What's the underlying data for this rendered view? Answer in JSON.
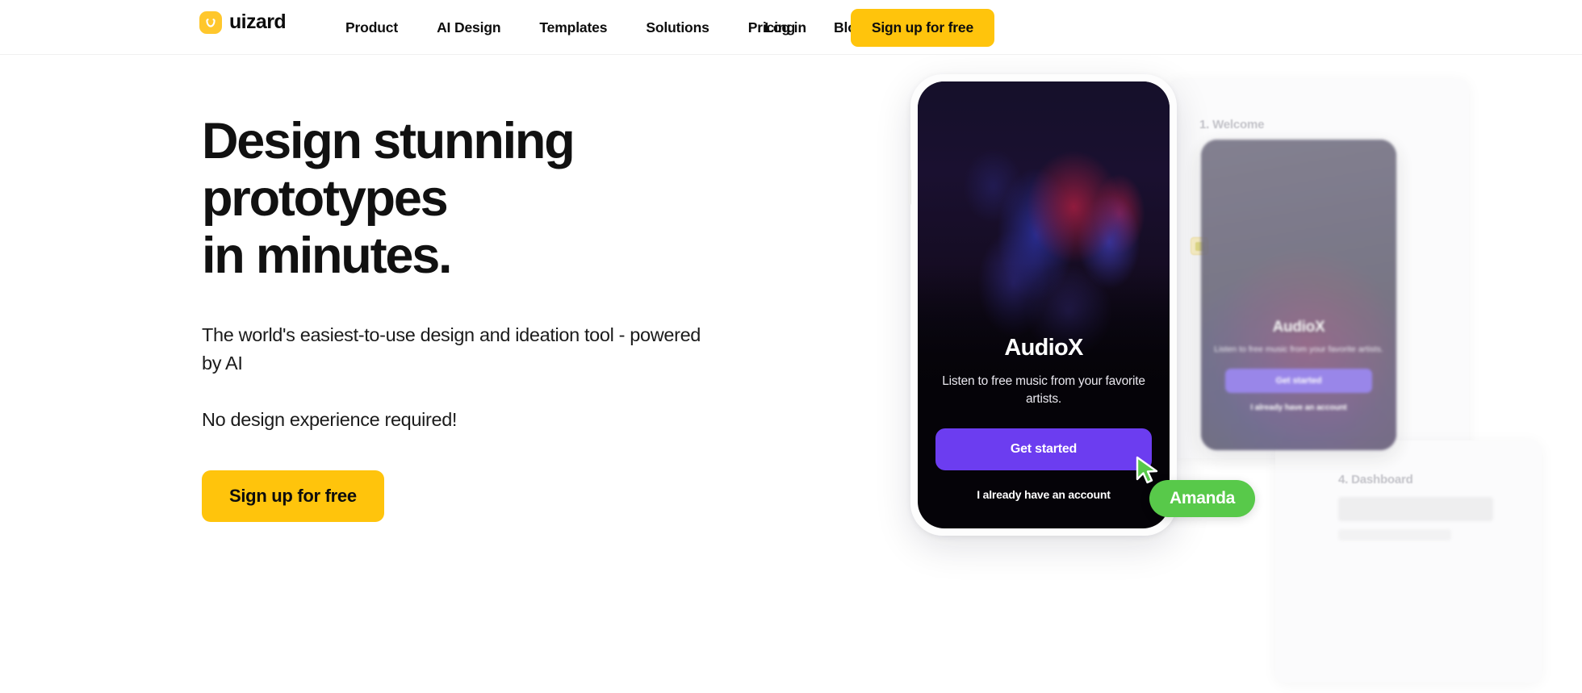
{
  "brand": {
    "name": "uizard",
    "logo_icon": "uizard-smiley-icon",
    "logo_color": "#ffc72c"
  },
  "header": {
    "nav_items": [
      {
        "label": "Product"
      },
      {
        "label": "AI Design"
      },
      {
        "label": "Templates"
      },
      {
        "label": "Solutions"
      },
      {
        "label": "Pricing"
      },
      {
        "label": "Blog"
      }
    ],
    "login_label": "Log in",
    "signup_label": "Sign up for free",
    "accent_color": "#ffc40c"
  },
  "hero": {
    "headline_line1": "Design stunning",
    "headline_line2": "prototypes",
    "headline_line3": "in minutes.",
    "subhead": "The world's easiest-to-use design and ideation tool - powered by AI",
    "subhead_2": "No design experience required!",
    "cta_label": "Sign up for free"
  },
  "mockup": {
    "canvas_labels": [
      {
        "label": "1. Welcome"
      },
      {
        "label": "4. Dashboard"
      }
    ],
    "front_phone": {
      "app_title": "AudioX",
      "app_subtitle": "Listen to free music from your favorite artists.",
      "primary_button": "Get started",
      "secondary_link": "I already have an account",
      "button_color": "#6c3df0",
      "screen_background": "#050308"
    },
    "back_phone": {
      "app_title": "AudioX",
      "app_subtitle": "Listen to free music from your favorite artists.",
      "primary_button": "Get started",
      "secondary_link": "I already have an account",
      "button_color": "#8f7ae8"
    },
    "collaborator": {
      "name": "Amanda",
      "cursor_color": "#58c94a"
    }
  }
}
